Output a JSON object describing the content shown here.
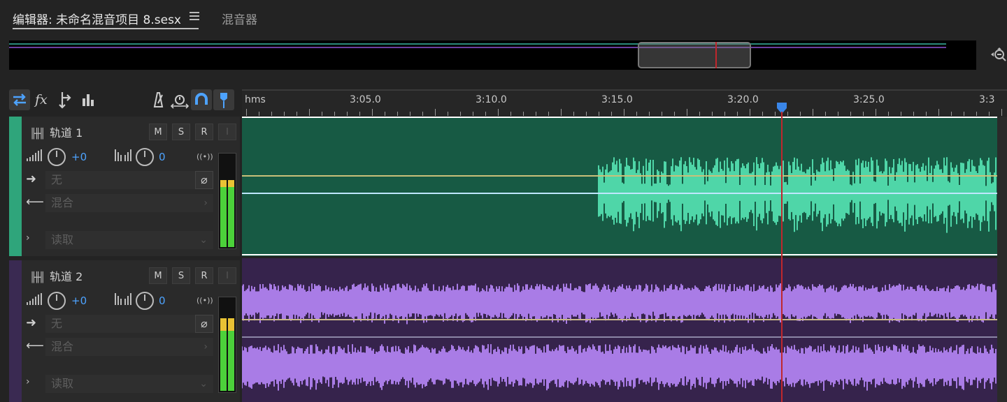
{
  "tabs": {
    "editor_label": "编辑器: 未命名混音项目 8.sesx",
    "mixer_label": "混音器"
  },
  "ruler": {
    "unit_label": "hms",
    "labels": [
      "3:05.0",
      "3:10.0",
      "3:15.0",
      "3:20.0",
      "3:25.0",
      "3:3"
    ]
  },
  "tracks": [
    {
      "name": "轨道 1",
      "mute": "M",
      "solo": "S",
      "record": "R",
      "input": "I",
      "volume": "+0",
      "pan": "0",
      "output_placeholder": "无",
      "send_label": "混合",
      "automation": "读取",
      "color": "#2fa57b",
      "clip_color": "#175a44",
      "wave_color": "#4fd6a8"
    },
    {
      "name": "轨道 2",
      "mute": "M",
      "solo": "S",
      "record": "R",
      "input": "I",
      "volume": "+0",
      "pan": "0",
      "output_placeholder": "无",
      "send_label": "混合",
      "automation": "读取",
      "color": "#3a2a52",
      "clip_color": "#36234c",
      "wave_color": "#a97ce6"
    }
  ],
  "colors": {
    "accent": "#4da3ff",
    "playhead": "#c0272d"
  }
}
